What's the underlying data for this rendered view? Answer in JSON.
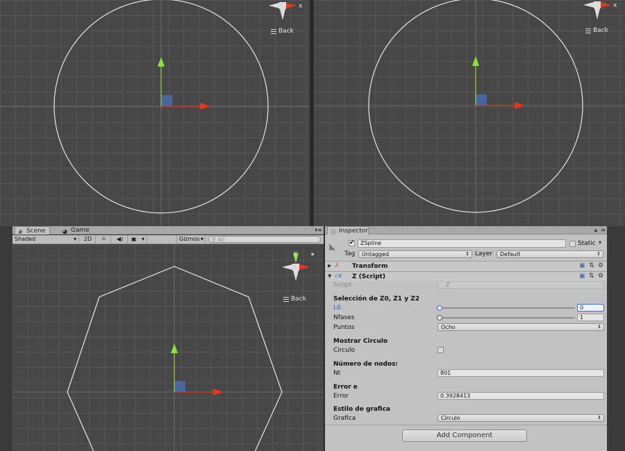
{
  "viewports": {
    "top_left": {
      "back_label": "Back"
    },
    "top_right": {
      "back_label": "Back"
    },
    "scene": {
      "back_label": "Back",
      "gizmo_axis_y": "y"
    }
  },
  "scene_panel": {
    "tabs": [
      {
        "label": "Scene",
        "icon": "grid-icon"
      },
      {
        "label": "Game",
        "icon": "pacman-icon"
      }
    ],
    "toolbar": {
      "shading_mode": "Shaded",
      "mode_2d": "2D",
      "gizmos_label": "Gizmos",
      "search_placeholder": "All"
    }
  },
  "inspector": {
    "tab_label": "Inspector",
    "object": {
      "active": true,
      "name": "ZSpline",
      "static_label": "Static",
      "tag_label": "Tag",
      "tag_value": "Untagged",
      "layer_label": "Layer",
      "layer_value": "Default"
    },
    "components": [
      {
        "name": "Transform",
        "expanded": false
      },
      {
        "name": "Z (Script)",
        "expanded": true
      }
    ],
    "script": {
      "script_label": "Script",
      "script_value": "Z",
      "section_selection": "Selección de Z0, Z1 y Z2",
      "l0_label": "L0",
      "l0_value": "0",
      "nfases_label": "Nfases",
      "nfases_value": "1",
      "puntos_label": "Puntos",
      "puntos_value": "Ocho",
      "section_circle": "Mostrar Circulo",
      "circulo_label": "Circulo",
      "circulo_checked": false,
      "section_nodes": "Número de nodos:",
      "nt_label": "Nt",
      "nt_value": "801",
      "section_error": "Error e",
      "error_label": "Error",
      "error_value": "0.3928413",
      "section_style": "Estilo de grafica",
      "grafica_label": "Grafica",
      "grafica_value": "Circulo"
    },
    "add_component_label": "Add Component"
  },
  "colors": {
    "x_axis": "#e8361e",
    "y_axis": "#8fdf3a",
    "origin_square": "#4a6ab0",
    "inspector_bg": "#c2c2c2",
    "viewport_bg": "#474747"
  }
}
